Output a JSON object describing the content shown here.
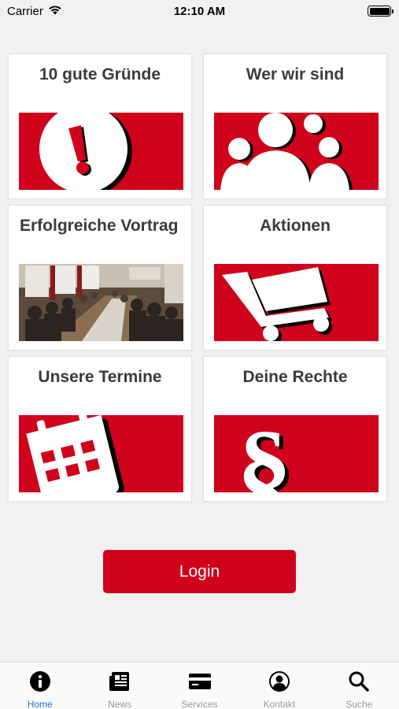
{
  "status_bar": {
    "carrier": "Carrier",
    "time": "12:10 AM"
  },
  "tiles": [
    {
      "title": "10 gute Gründe",
      "icon": "exclamation-icon"
    },
    {
      "title": "Wer wir sind",
      "icon": "people-group-icon"
    },
    {
      "title": "Erfolgreiche Vortrag",
      "icon": "meeting-photo"
    },
    {
      "title": "Aktionen",
      "icon": "shopping-cart-icon"
    },
    {
      "title": "Unsere Termine",
      "icon": "calendar-icon"
    },
    {
      "title": "Deine Rechte",
      "icon": "paragraph-icon"
    }
  ],
  "login": {
    "label": "Login"
  },
  "tab_bar": {
    "items": [
      {
        "label": "Home",
        "icon": "info-icon",
        "active": true
      },
      {
        "label": "News",
        "icon": "newspaper-icon",
        "active": false
      },
      {
        "label": "Services",
        "icon": "card-icon",
        "active": false
      },
      {
        "label": "Kontakt",
        "icon": "person-icon",
        "active": false
      },
      {
        "label": "Suche",
        "icon": "search-icon",
        "active": false
      }
    ]
  },
  "colors": {
    "brand_red": "#d0021b",
    "active_tab": "#1a73e8",
    "inactive_tab": "#9a9a9a",
    "background": "#f1f1f1"
  }
}
